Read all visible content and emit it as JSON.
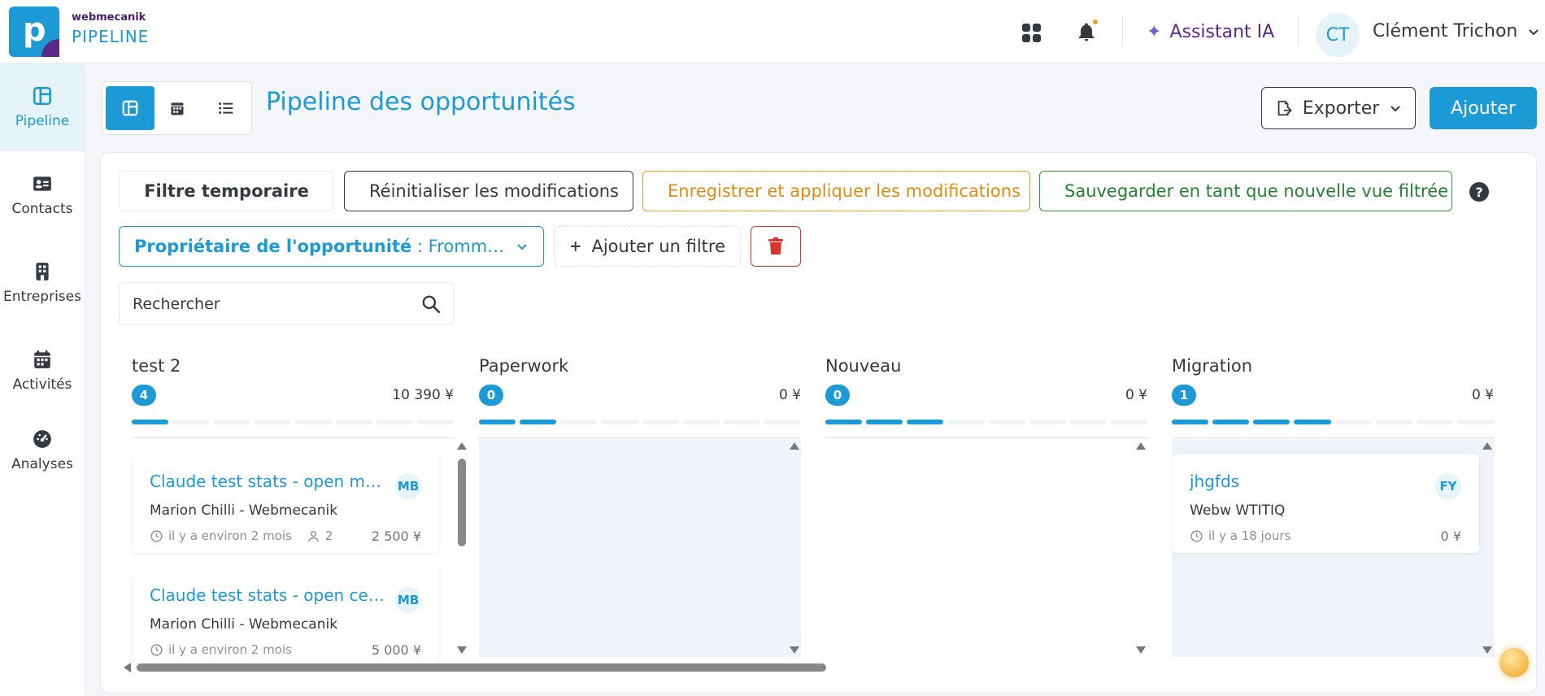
{
  "brand": {
    "small": "webmecanik",
    "big": "PIPELINE",
    "logo_letter": "p"
  },
  "header": {
    "assistant_label": "Assistant IA",
    "user_initials": "CT",
    "user_name": "Clément Trichon"
  },
  "sidebar": {
    "items": [
      {
        "label": "Pipeline",
        "icon": "pipeline-icon",
        "active": true
      },
      {
        "label": "Contacts",
        "icon": "contact-card-icon"
      },
      {
        "label": "Entreprises",
        "icon": "building-icon"
      },
      {
        "label": "Activités",
        "icon": "calendar-icon"
      },
      {
        "label": "Analyses",
        "icon": "gauge-icon"
      }
    ]
  },
  "toolbar": {
    "page_title": "Pipeline des opportunités",
    "export_label": "Exporter",
    "add_label": "Ajouter"
  },
  "filters": {
    "temp_label": "Filtre temporaire",
    "reset_label": "Réinitialiser les modifications",
    "save_label": "Enregistrer et appliquer les modifications",
    "new_view_label": "Sauvegarder en tant que nouvelle vue filtrée",
    "help": "?",
    "owner_key": "Propriétaire de l'opportunité",
    "owner_value": " : Frommelt, M...",
    "add_filter_label": "Ajouter un filtre"
  },
  "search": {
    "placeholder": "Rechercher"
  },
  "columns": [
    {
      "name": "test 2",
      "count": "4",
      "total": "10 390 ¥",
      "steps_on": 1
    },
    {
      "name": "Paperwork",
      "count": "0",
      "total": "0 ¥",
      "steps_on": 2
    },
    {
      "name": "Nouveau",
      "count": "0",
      "total": "0 ¥",
      "steps_on": 3
    },
    {
      "name": "Migration",
      "count": "1",
      "total": "0 ¥",
      "steps_on": 4
    }
  ],
  "cards": {
    "c1": {
      "title": "Claude test stats - open moi...",
      "owner": "MB",
      "company": "Marion Chilli - Webmecanik",
      "time": "il y a environ 2 mois",
      "people": "2",
      "amount": "2 500 ¥"
    },
    "c2": {
      "title": "Claude test stats - open ce ...",
      "owner": "MB",
      "company": "Marion Chilli - Webmecanik",
      "time": "il y a environ 2 mois",
      "amount": "5 000 ¥"
    },
    "c3": {
      "title": "jhgfds",
      "owner": "FY",
      "company": "Webw WTITIQ",
      "time": "il y a 18 jours",
      "amount": "0 ¥"
    }
  },
  "colors": {
    "primary": "#1b9ad6",
    "brand_purple": "#5b2a86",
    "warning": "#f0a020",
    "success": "#2e9b3c",
    "danger": "#d9342b"
  }
}
